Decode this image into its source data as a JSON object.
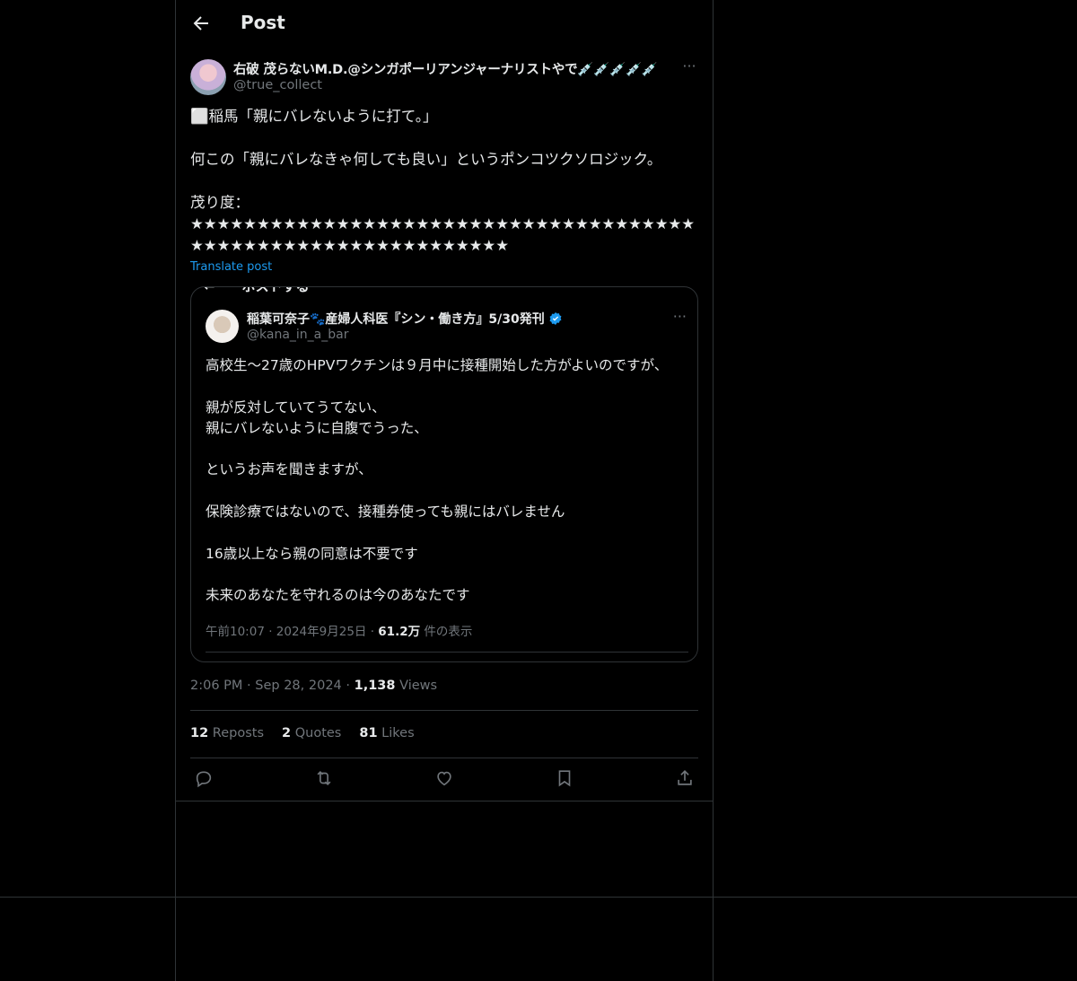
{
  "header": {
    "title": "Post"
  },
  "author": {
    "display_name": "右破 茂らないM.D.@シンガポーリアンジャーナリストやで💉💉💉💉💉",
    "handle": "@true_collect"
  },
  "post": {
    "text": "⬜稲馬「親にバレないように打て。」\n\n何この「親にバレなきゃ何しても良い」というポンコツクソロジック。\n\n茂り度：\n★★★★★★★★★★★★★★★★★★★★★★★★★★★★★★★★★★★★★★★★★★★★★★★★★★★★★★★★★★★★★★",
    "translate_label": "Translate post"
  },
  "quote": {
    "cut_text": "←　　ポストする",
    "display_name": "稲葉可奈子🐾産婦人科医『シン・働き方』5/30発刊",
    "handle": "@kana_in_a_bar",
    "text": "高校生〜27歳のHPVワクチンは９月中に接種開始した方がよいのですが、\n\n親が反対していてうてない、\n親にバレないように自腹でうった、\n\nというお声を聞きますが、\n\n保険診療ではないので、接種券使っても親にはバレません\n\n16歳以上なら親の同意は不要です\n\n未来のあなたを守れるのは今のあなたです",
    "timestamp": "午前10:07 · 2024年9月25日 · ",
    "views_count": "61.2万",
    "views_label": " 件の表示"
  },
  "meta": {
    "time": "2:06 PM",
    "sep1": " · ",
    "date": "Sep 28, 2024",
    "sep2": " · ",
    "views_count": "1,138",
    "views_label": " Views"
  },
  "stats": {
    "reposts_count": "12",
    "reposts_label": " Reposts",
    "quotes_count": "2",
    "quotes_label": " Quotes",
    "likes_count": "81",
    "likes_label": " Likes"
  },
  "icons": [
    "back-arrow-icon",
    "more-icon",
    "verified-icon",
    "reply-icon",
    "repost-icon",
    "like-icon",
    "bookmark-icon",
    "share-icon"
  ],
  "colors": {
    "background": "#000000",
    "text": "#e7e9ea",
    "muted": "#71767b",
    "accent": "#1d9bf0",
    "border": "#2f3336"
  }
}
